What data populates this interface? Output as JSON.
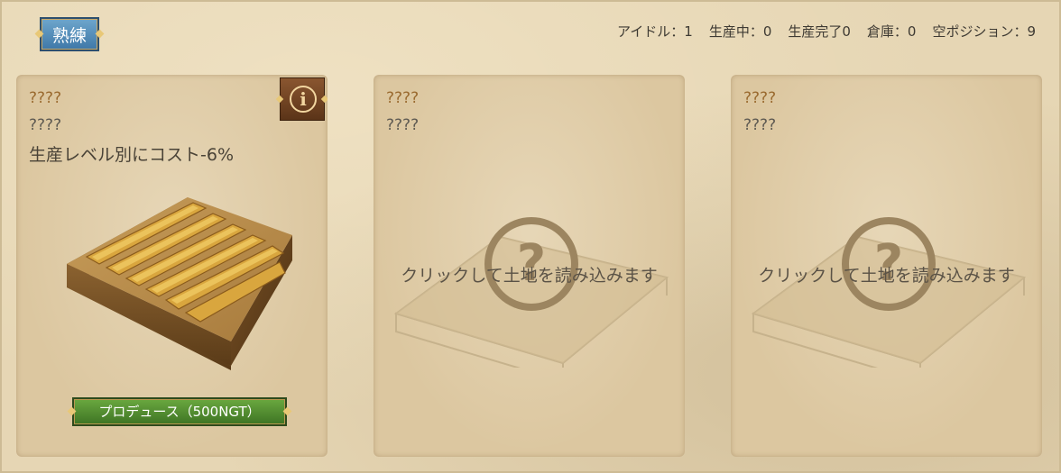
{
  "header": {
    "skill_label": "熟練",
    "status": {
      "idle": "アイドル：1",
      "producing": "生産中：0",
      "done": "生産完了0",
      "warehouse": "倉庫：0",
      "empty": "空ポジション：9"
    }
  },
  "cards": [
    {
      "line1": "????",
      "line2": "????",
      "bonus": "生産レベル別にコスト-6%",
      "info_icon": "info-icon",
      "button_label": "プロデュース（500NGT）"
    },
    {
      "line1": "????",
      "line2": "????",
      "load_text": "クリックして土地を読み込みます",
      "icon": "question-mark-icon"
    },
    {
      "line1": "????",
      "line2": "????",
      "load_text": "クリックして土地を読み込みます",
      "icon": "question-mark-icon"
    }
  ],
  "colors": {
    "background": "#e6d6b4",
    "card": "#dcc7a0",
    "skill_button": "#4f88b8",
    "produce_button": "#4e8a2e",
    "question_text": "#9a6a2f"
  }
}
